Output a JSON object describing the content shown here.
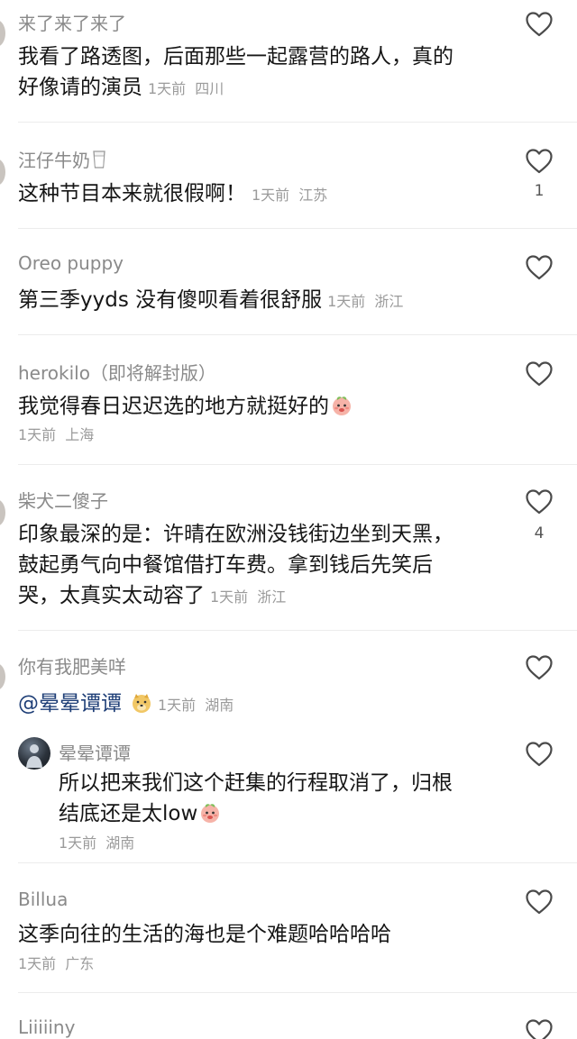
{
  "comments": [
    {
      "username": "来了来了来了",
      "lines": [
        "我看了路透图，后面那些一起露营的路人，真的",
        "好像请的演员"
      ],
      "time": "1天前",
      "location": "四川"
    },
    {
      "username": "汪仔牛奶",
      "lines": [
        "这种节目本来就很假啊！"
      ],
      "time": "1天前",
      "location": "江苏",
      "likes": "1"
    },
    {
      "username": "Oreo puppy",
      "lines": [
        "第三季yyds 没有傻呗看着很舒服"
      ],
      "time": "1天前",
      "location": "浙江"
    },
    {
      "username": "herokilo（即将解封版）",
      "lines": [
        "我觉得春日迟迟选的地方就挺好的"
      ],
      "time": "1天前",
      "location": "上海"
    },
    {
      "username": "柴犬二傻子",
      "lines": [
        "印象最深的是：许晴在欧洲没钱街边坐到天黑，",
        "鼓起勇气向中餐馆借打车费。拿到钱后先笑后",
        "哭，太真实太动容了"
      ],
      "time": "1天前",
      "location": "浙江",
      "likes": "4"
    },
    {
      "username": "你有我肥美咩",
      "mention": "@晕晕谭谭",
      "time": "1天前",
      "location": "湖南"
    },
    {
      "username": "Billua",
      "lines": [
        "这季向往的生活的海也是个难题哈哈哈哈"
      ],
      "time": "1天前",
      "location": "广东"
    },
    {
      "username": "Liiiiiny"
    }
  ],
  "reply": {
    "username": "晕晕谭谭",
    "lines": [
      "所以把来我们这个赶集的行程取消了，归根",
      "结底还是太low"
    ],
    "time": "1天前",
    "location": "湖南"
  },
  "icons": {
    "like": "heart-outline-icon",
    "peach_emoji": "peach-emoji-icon",
    "doge_emoji": "doge-emoji-icon",
    "milk": "milk-glass-icon"
  },
  "colors": {
    "username": "#8a8a8a",
    "text": "#161616",
    "meta": "#9b9b9b",
    "mention": "#1f3f77"
  }
}
